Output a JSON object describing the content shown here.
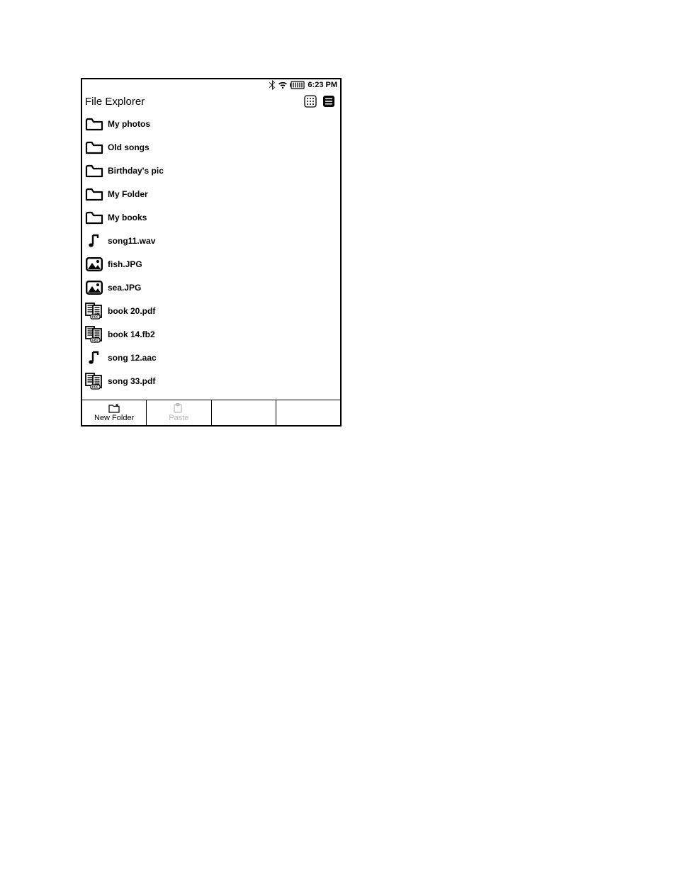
{
  "status": {
    "time": "6:23 PM"
  },
  "header": {
    "title": "File Explorer"
  },
  "files": [
    {
      "name": "My photos",
      "type": "folder"
    },
    {
      "name": "Old songs",
      "type": "folder"
    },
    {
      "name": "Birthday's pic",
      "type": "folder"
    },
    {
      "name": "My Folder",
      "type": "folder"
    },
    {
      "name": "My books",
      "type": "folder"
    },
    {
      "name": "song11.wav",
      "type": "audio"
    },
    {
      "name": "fish.JPG",
      "type": "image"
    },
    {
      "name": "sea.JPG",
      "type": "image"
    },
    {
      "name": "book 20.pdf",
      "type": "pdf"
    },
    {
      "name": "book 14.fb2",
      "type": "fb2"
    },
    {
      "name": "song 12.aac",
      "type": "audio"
    },
    {
      "name": "song 33.pdf",
      "type": "pdf"
    }
  ],
  "bottom": {
    "new_folder": "New Folder",
    "paste": "Paste"
  }
}
